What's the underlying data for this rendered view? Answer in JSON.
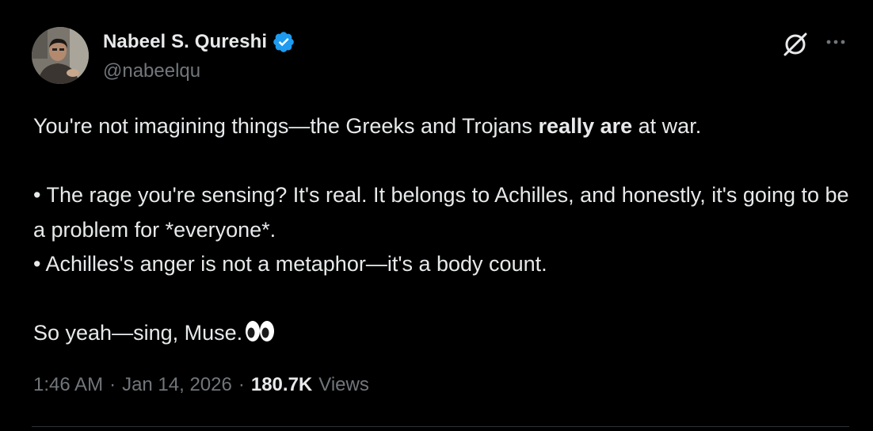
{
  "author": {
    "display_name": "Nabeel S. Qureshi",
    "handle": "@nabeelqu",
    "verified": true
  },
  "tweet": {
    "line1_before": "You're not imagining things—the Greeks and Trojans ",
    "line1_bold": "really are",
    "line1_after": " at war.",
    "bullet1": "• The rage you're sensing? It's real. It belongs to Achilles, and honestly, it's going to be a problem for *everyone*.",
    "bullet2": "• Achilles's anger is not a metaphor—it's a body count.",
    "closing": "So yeah—sing, Muse.",
    "closing_emoji": "eyes-icon"
  },
  "meta": {
    "time": "1:46 AM",
    "separator": "·",
    "date": "Jan 14, 2026",
    "views_count": "180.7K",
    "views_label": "Views"
  },
  "icons": {
    "verified": "verified-badge-icon",
    "grok": "grok-icon",
    "more": "more-options-icon"
  },
  "colors": {
    "background": "#000000",
    "text_primary": "#e7e9ea",
    "text_secondary": "#71767b",
    "verified_blue": "#1d9bf0",
    "divider": "#2f3336"
  }
}
